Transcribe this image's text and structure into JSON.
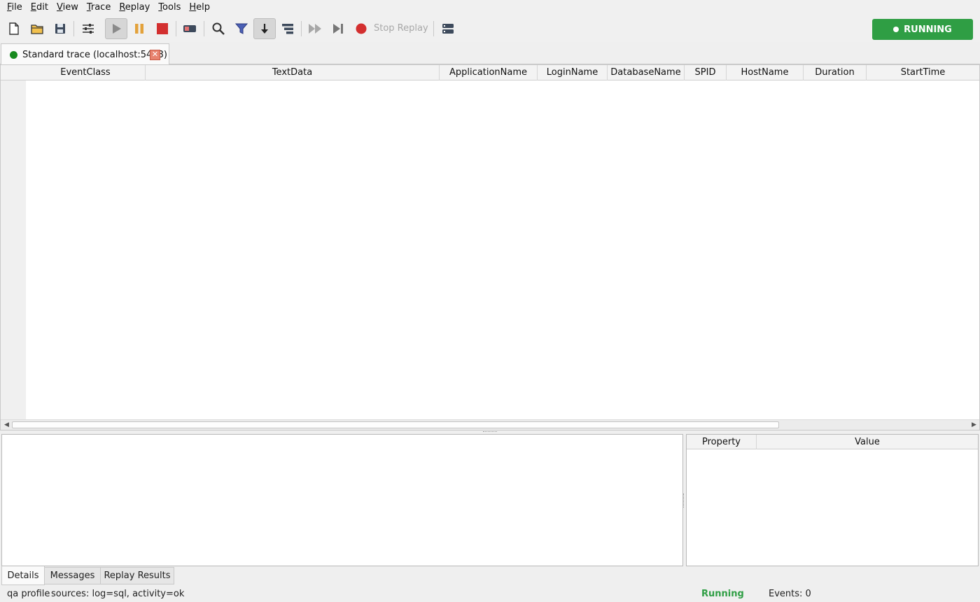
{
  "menu": [
    {
      "label": "File",
      "mnemonic": "F",
      "rest": "ile"
    },
    {
      "label": "Edit",
      "mnemonic": "E",
      "rest": "dit"
    },
    {
      "label": "View",
      "mnemonic": "V",
      "rest": "iew"
    },
    {
      "label": "Trace",
      "mnemonic": "T",
      "rest": "race"
    },
    {
      "label": "Replay",
      "mnemonic": "R",
      "rest": "eplay"
    },
    {
      "label": "Tools",
      "mnemonic": "T",
      "rest": "ools"
    },
    {
      "label": "Help",
      "mnemonic": "H",
      "rest": "elp"
    }
  ],
  "toolbar": {
    "stop_replay_label": "Stop Replay",
    "status_label": "RUNNING",
    "icons": [
      "new-file-icon",
      "open-folder-icon",
      "save-icon",
      "properties-icon",
      "play-icon",
      "pause-icon",
      "stop-icon",
      "clear-icon",
      "find-icon",
      "filter-icon",
      "autoscroll-icon",
      "group-icon",
      "replay-fast-icon",
      "replay-step-icon",
      "record-icon",
      "server-icon"
    ]
  },
  "trace_tab": {
    "label": "Standard trace (localhost:5433)",
    "close_glyph": "✕"
  },
  "grid": {
    "columns": [
      "EventClass",
      "TextData",
      "ApplicationName",
      "LoginName",
      "DatabaseName",
      "SPID",
      "HostName",
      "Duration",
      "StartTime"
    ],
    "rows": []
  },
  "properties": {
    "columns": [
      "Property",
      "Value"
    ],
    "rows": []
  },
  "bottom_tabs": [
    "Details",
    "Messages",
    "Replay Results"
  ],
  "status": {
    "profile": "qa profile",
    "sources": "sources: log=sql, activity=ok",
    "state": "Running",
    "events": "Events: 0"
  },
  "colors": {
    "running_green": "#2f9e44",
    "stop_red": "#d32f2f",
    "pause_orange": "#e3a23b",
    "record_red": "#d32f2f"
  }
}
